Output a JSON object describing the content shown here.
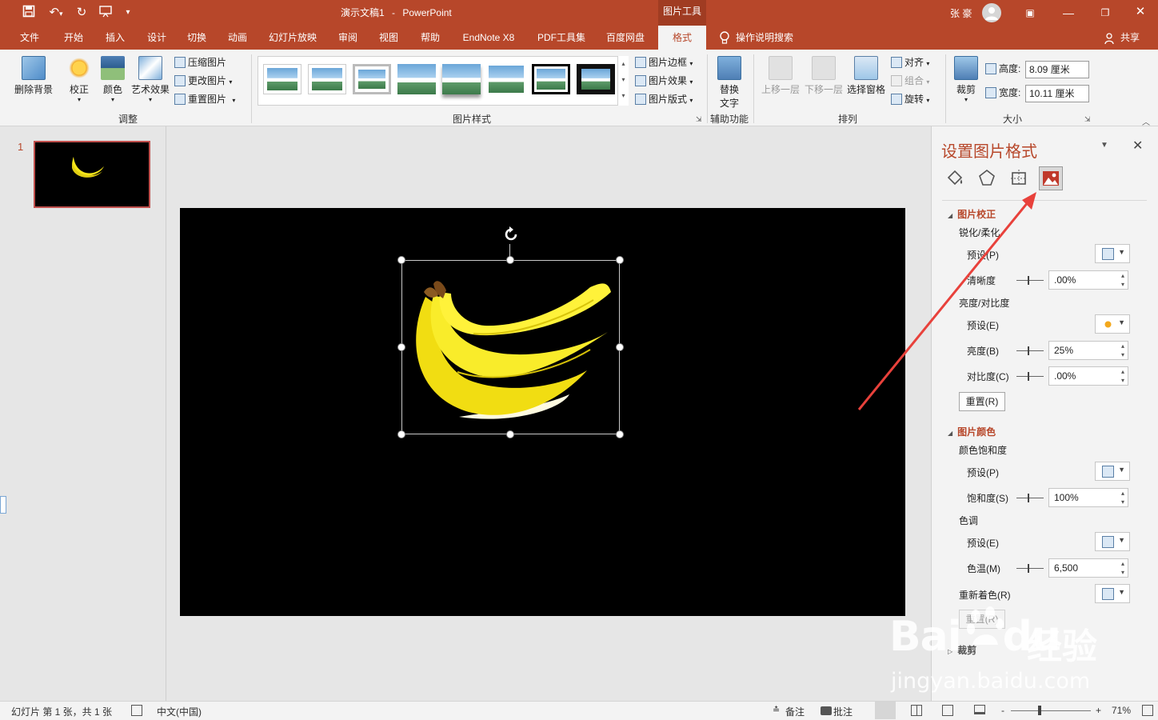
{
  "window": {
    "doc_title": "演示文稿1",
    "title_sep": "-",
    "app_name": "PowerPoint",
    "context_tab_group": "图片工具",
    "user_name": "张 豪"
  },
  "tabs": [
    "文件",
    "开始",
    "插入",
    "设计",
    "切换",
    "动画",
    "幻灯片放映",
    "审阅",
    "视图",
    "帮助",
    "EndNote X8",
    "PDF工具集",
    "百度网盘",
    "格式"
  ],
  "active_tab": "格式",
  "tell_me": "操作说明搜索",
  "share": "共享",
  "ribbon": {
    "adjust": {
      "remove_bg": "删除背景",
      "corrections": "校正",
      "color": "颜色",
      "artistic": "艺术效果",
      "compress": "压缩图片",
      "change": "更改图片",
      "reset": "重置图片",
      "label": "调整"
    },
    "styles": {
      "label": "图片样式",
      "border": "图片边框",
      "effects": "图片效果",
      "layout": "图片版式"
    },
    "accessibility": {
      "alt_text_1": "替换",
      "alt_text_2": "文字",
      "label": "辅助功能"
    },
    "arrange": {
      "bring_forward": "上移一层",
      "send_backward": "下移一层",
      "selection_pane": "选择窗格",
      "align": "对齐",
      "group": "组合",
      "rotate": "旋转",
      "label": "排列"
    },
    "size": {
      "crop": "裁剪",
      "height_label": "高度:",
      "height_value": "8.09 厘米",
      "width_label": "宽度:",
      "width_value": "10.11 厘米",
      "label": "大小"
    }
  },
  "slides_pane": {
    "slide_number": "1"
  },
  "format_pane": {
    "title": "设置图片格式",
    "corrections_header": "图片校正",
    "sharpen_soften": "锐化/柔化",
    "preset_p": "预设(P)",
    "sharpness": "清晰度",
    "sharpness_value": ".00%",
    "brightness_contrast": "亮度/对比度",
    "preset_e": "预设(E)",
    "brightness": "亮度(B)",
    "brightness_value": "25%",
    "contrast": "对比度(C)",
    "contrast_value": ".00%",
    "reset": "重置(R)",
    "color_header": "图片颜色",
    "saturation_group": "颜色饱和度",
    "preset_p2": "预设(P)",
    "saturation": "饱和度(S)",
    "saturation_value": "100%",
    "tone_group": "色调",
    "preset_e2": "预设(E)",
    "temperature": "色温(M)",
    "temperature_value": "6,500",
    "recolor": "重新着色(R)",
    "reset2": "重置(R)",
    "crop_section": "裁剪"
  },
  "status": {
    "slide_info": "幻灯片 第 1 张，共 1 张",
    "language": "中文(中国)",
    "notes": "备注",
    "comments": "批注",
    "zoom": "71%",
    "zoom_minus": "-",
    "zoom_plus": "+"
  },
  "watermark": {
    "brand_text_1": "Bai",
    "brand_text_2": "du",
    "brand_cn": "经验",
    "url": "jingyan.baidu.com"
  },
  "colors": {
    "accent": "#b7472a",
    "slide_bg": "#000000",
    "banana": "#f5e51a",
    "arrow": "#e8413b"
  }
}
